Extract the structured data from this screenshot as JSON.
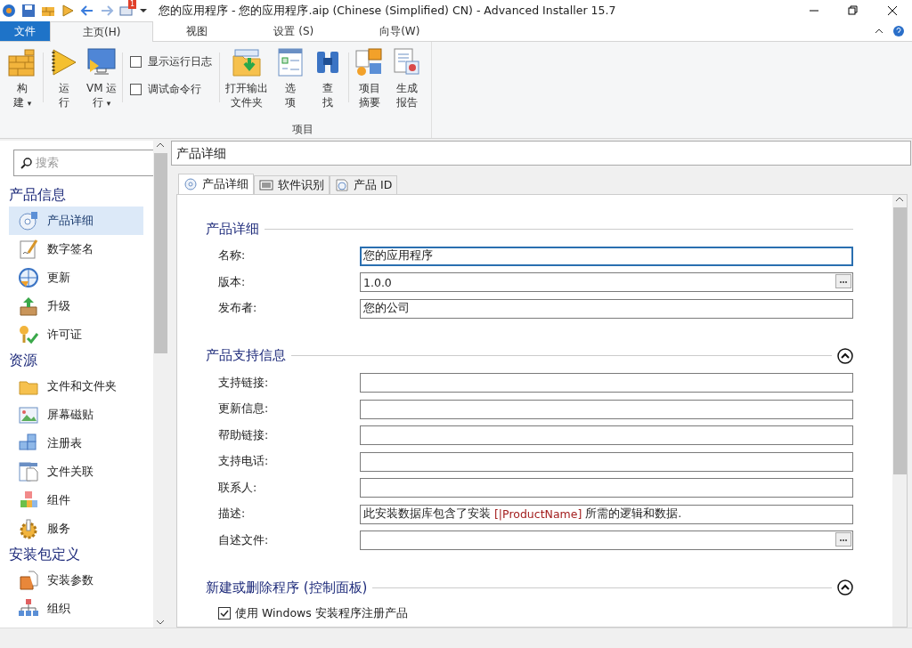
{
  "window": {
    "title": "您的应用程序 - 您的应用程序.aip (Chinese (Simplified) CN) - Advanced Installer 15.7",
    "badge": "1"
  },
  "ribbon": {
    "tabs": [
      {
        "label": "文件",
        "selected": false,
        "kind": "file"
      },
      {
        "label": "主页(H)",
        "selected": true,
        "kind": "tab"
      },
      {
        "label": "视图",
        "selected": false,
        "kind": "tab"
      },
      {
        "label": "设置 (S)",
        "selected": false,
        "kind": "tab"
      },
      {
        "label": "向导(W)",
        "selected": false,
        "kind": "tab"
      }
    ],
    "groups": [
      {
        "buttons": [
          {
            "lines": [
              "构",
              "建"
            ],
            "caret": "▾"
          }
        ]
      },
      {
        "buttons": [
          {
            "lines": [
              "运",
              "行"
            ]
          },
          {
            "lines": [
              "VM 运",
              "行"
            ],
            "caret": "▾"
          }
        ]
      },
      {
        "checkboxes": [
          {
            "label": "显示运行日志",
            "checked": false
          },
          {
            "label": "调试命令行",
            "checked": false
          }
        ]
      },
      {
        "buttons": [
          {
            "lines": [
              "打开输出",
              "文件夹"
            ]
          },
          {
            "lines": [
              "选",
              "项"
            ]
          },
          {
            "lines": [
              "查",
              "找"
            ]
          }
        ]
      },
      {
        "buttons": [
          {
            "lines": [
              "项目",
              "摘要"
            ]
          },
          {
            "lines": [
              "生成",
              "报告"
            ]
          }
        ]
      }
    ],
    "group_label": "项目"
  },
  "sidebar": {
    "search": {
      "placeholder": "搜索"
    },
    "sections": [
      {
        "title": "产品信息",
        "items": [
          {
            "label": "产品详细",
            "selected": true
          },
          {
            "label": "数字签名",
            "selected": false
          },
          {
            "label": "更新",
            "selected": false
          },
          {
            "label": "升级",
            "selected": false
          },
          {
            "label": "许可证",
            "selected": false
          }
        ]
      },
      {
        "title": "资源",
        "items": [
          {
            "label": "文件和文件夹",
            "selected": false
          },
          {
            "label": "屏幕磁贴",
            "selected": false
          },
          {
            "label": "注册表",
            "selected": false
          },
          {
            "label": "文件关联",
            "selected": false
          },
          {
            "label": "组件",
            "selected": false
          },
          {
            "label": "服务",
            "selected": false
          }
        ]
      },
      {
        "title": "安装包定义",
        "items": [
          {
            "label": "安装参数",
            "selected": false
          },
          {
            "label": "组织",
            "selected": false
          }
        ]
      }
    ]
  },
  "main": {
    "header": "产品详细",
    "tabs": [
      {
        "label": "产品详细",
        "selected": true
      },
      {
        "label": "软件识别",
        "selected": false
      },
      {
        "label": "产品 ID",
        "selected": false
      }
    ],
    "sections": [
      {
        "title": "产品详细",
        "collapsible": false,
        "fields": [
          {
            "label": "名称:",
            "value": [
              {
                "text": "您的应用程序",
                "kind": "plain"
              }
            ],
            "browse": false,
            "focused": true
          },
          {
            "label": "版本:",
            "value": [
              {
                "text": "1.0.0",
                "kind": "plain"
              }
            ],
            "browse": true,
            "focused": false
          },
          {
            "label": "发布者:",
            "value": [
              {
                "text": "您的公司",
                "kind": "plain"
              }
            ],
            "browse": false,
            "focused": false
          }
        ]
      },
      {
        "title": "产品支持信息",
        "collapsible": true,
        "fields": [
          {
            "label": "支持链接:",
            "browse": false,
            "focused": false
          },
          {
            "label": "更新信息:",
            "browse": false,
            "focused": false
          },
          {
            "label": "帮助链接:",
            "browse": false,
            "focused": false
          },
          {
            "label": "支持电话:",
            "browse": false,
            "focused": false
          },
          {
            "label": "联系人:",
            "browse": false,
            "focused": false
          },
          {
            "label": "描述:",
            "value": [
              {
                "text": "此安装数据库包含了安装 ",
                "kind": "plain"
              },
              {
                "text": "[|ProductName]",
                "kind": "token"
              },
              {
                "text": " 所需的逻辑和数据.",
                "kind": "plain"
              }
            ],
            "browse": false,
            "focused": false
          },
          {
            "label": "自述文件:",
            "browse": true,
            "focused": false
          }
        ]
      },
      {
        "title": "新建或删除程序 (控制面板)",
        "collapsible": true,
        "checkboxes": [
          {
            "label": "使用 Windows 安装程序注册产品",
            "checked": true
          }
        ]
      }
    ]
  }
}
